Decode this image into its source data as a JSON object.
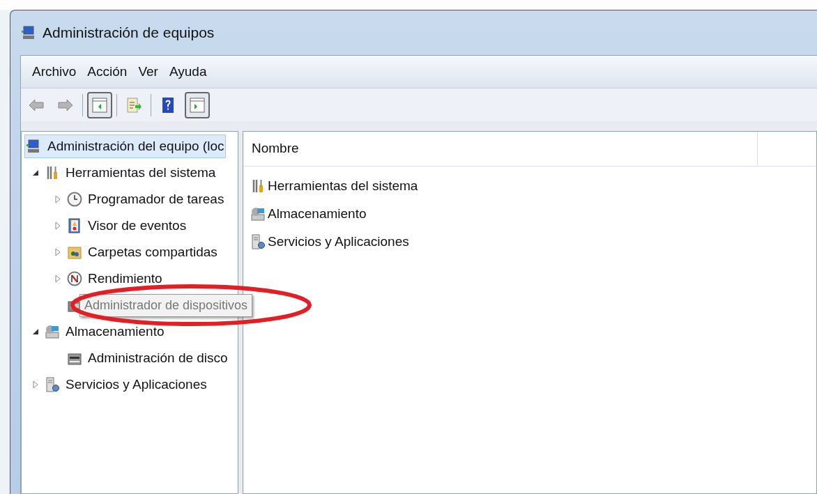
{
  "window": {
    "title": "Administración de equipos"
  },
  "menu": [
    "Archivo",
    "Acción",
    "Ver",
    "Ayuda"
  ],
  "toolbar": [
    {
      "kind": "back",
      "disabled": true
    },
    {
      "kind": "forward",
      "disabled": true
    },
    {
      "kind": "sep"
    },
    {
      "kind": "tree-toggle",
      "selected": true
    },
    {
      "kind": "sep"
    },
    {
      "kind": "export",
      "selected": false
    },
    {
      "kind": "sep"
    },
    {
      "kind": "help",
      "selected": false
    },
    {
      "kind": "action-toggle",
      "selected": true
    }
  ],
  "tree": [
    {
      "label": "Administración del equipo (loc",
      "kind": "computer",
      "selected": true,
      "children": [
        {
          "label": "Herramientas del sistema",
          "kind": "tools",
          "selected": false,
          "expanded": true,
          "children": [
            {
              "label": "Programador de tareas",
              "kind": "clock",
              "selected": false,
              "expanded": false
            },
            {
              "label": "Visor de eventos",
              "kind": "log",
              "selected": false,
              "expanded": false
            },
            {
              "label": "Carpetas compartidas",
              "kind": "folder",
              "selected": false,
              "expanded": false
            },
            {
              "label": "Rendimiento",
              "kind": "gauge",
              "selected": false,
              "expanded": false
            },
            {
              "label": "Administrador de dispositivos",
              "kind": "device",
              "selected": false,
              "tooltip": true
            }
          ]
        },
        {
          "label": "Almacenamiento",
          "kind": "storage",
          "selected": false,
          "expanded": true,
          "children": [
            {
              "label": "Administración de disco",
              "kind": "disk",
              "selected": false
            }
          ]
        },
        {
          "label": "Servicios y Aplicaciones",
          "kind": "services",
          "selected": false,
          "expanded": false
        }
      ]
    }
  ],
  "list": {
    "columns": [
      "Nombre"
    ],
    "rows": [
      {
        "name": "Herramientas del sistema",
        "kind": "tools"
      },
      {
        "name": "Almacenamiento",
        "kind": "storage"
      },
      {
        "name": "Servicios y Aplicaciones",
        "kind": "services"
      }
    ]
  },
  "highlight": {
    "kind": "ellipse",
    "color": "#e31e24"
  }
}
